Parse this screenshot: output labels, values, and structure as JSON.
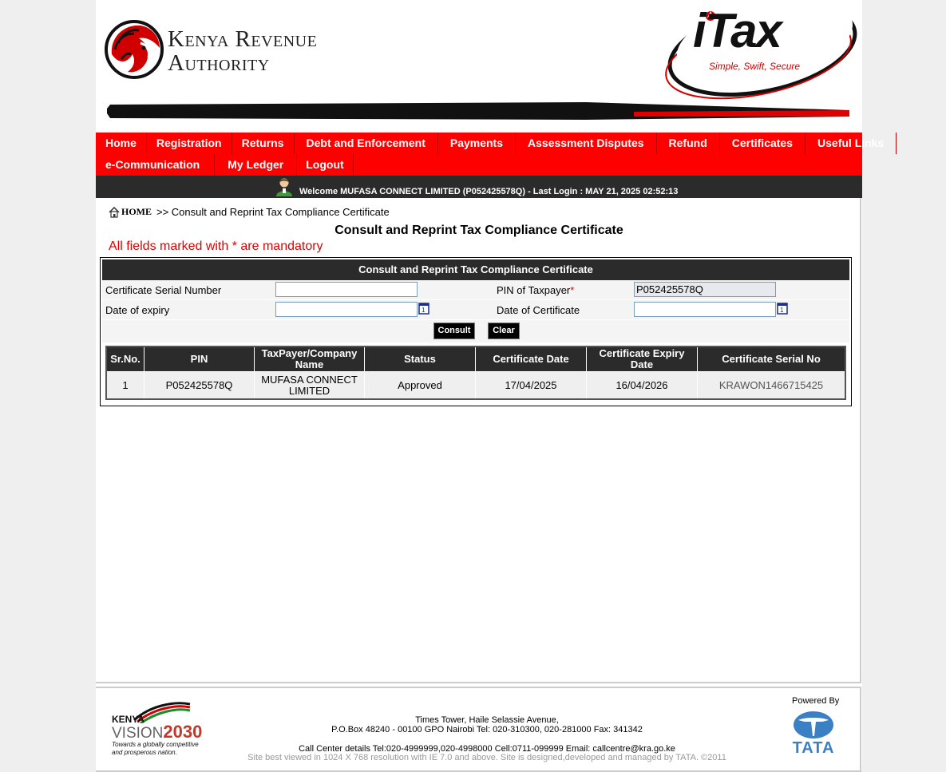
{
  "header": {
    "org_line1": "Kenya Revenue",
    "org_line2": "Authority",
    "itax_brand": "iTax",
    "itax_tagline": "Simple, Swift, Secure"
  },
  "nav": {
    "row1": [
      "Home",
      "Registration",
      "Returns",
      "Debt and Enforcement",
      "Payments",
      "Assessment Disputes",
      "Refund",
      "Certificates",
      "Useful Links"
    ],
    "row2": [
      "e-Communication",
      "My Ledger",
      "Logout"
    ]
  },
  "welcome": {
    "text": "Welcome MUFASA CONNECT LIMITED (P052425578Q)  - Last Login : MAY 21, 2025 02:52:13"
  },
  "breadcrumb": {
    "home": "HOME",
    "current": ">> Consult and Reprint Tax Compliance Certificate"
  },
  "page_title": "Consult and Reprint Tax Compliance Certificate",
  "mandatory_note": "All fields marked with * are mandatory",
  "form": {
    "panel_title": "Consult and Reprint Tax Compliance Certificate",
    "serial_label": "Certificate Serial Number",
    "serial_value": "",
    "pin_label": "PIN of Taxpayer",
    "pin_required": "*",
    "pin_value": "P052425578Q",
    "expiry_label": "Date of expiry",
    "expiry_value": "",
    "cert_date_label": "Date of Certificate",
    "cert_date_value": "",
    "consult_label": "Consult",
    "clear_label": "Clear"
  },
  "results": {
    "headers": [
      "Sr.No.",
      "PIN",
      "TaxPayer/Company Name",
      "Status",
      "Certificate Date",
      "Certificate Expiry Date",
      "Certificate Serial No"
    ],
    "rows": [
      {
        "sr": "1",
        "pin": "P052425578Q",
        "name": "MUFASA CONNECT LIMITED",
        "status": "Approved",
        "cert_date": "17/04/2025",
        "expiry_date": "16/04/2026",
        "serial": "KRAWON1466715425"
      }
    ]
  },
  "footer": {
    "vision_kenya": "KENYA",
    "vision_text": "VISION",
    "vision_year": "2030",
    "vision_tagline1": "Towards a globally competitive",
    "vision_tagline2": "and prosperous nation.",
    "address1": "Times Tower, Haile Selassie Avenue,",
    "address2": "P.O.Box 48240 - 00100 GPO Nairobi Tel: 020-310300, 020-281000 Fax: 341342",
    "call_center": "Call Center details Tel:020-4999999,020-4998000 Cell:0711-099999 Email: callcentre@kra.go.ke",
    "site_note": "Site best viewed in 1024 X 768 resolution with IE 7.0 and above. Site is designed,developed and managed by TATA. ©2011",
    "powered_by": "Powered By",
    "tata": "TATA"
  },
  "colors": {
    "nav_red": "#ff0000",
    "dark_bar": "#2b2b2b",
    "mandatory_red": "#e00000",
    "tata_blue": "#3b7fc4"
  }
}
